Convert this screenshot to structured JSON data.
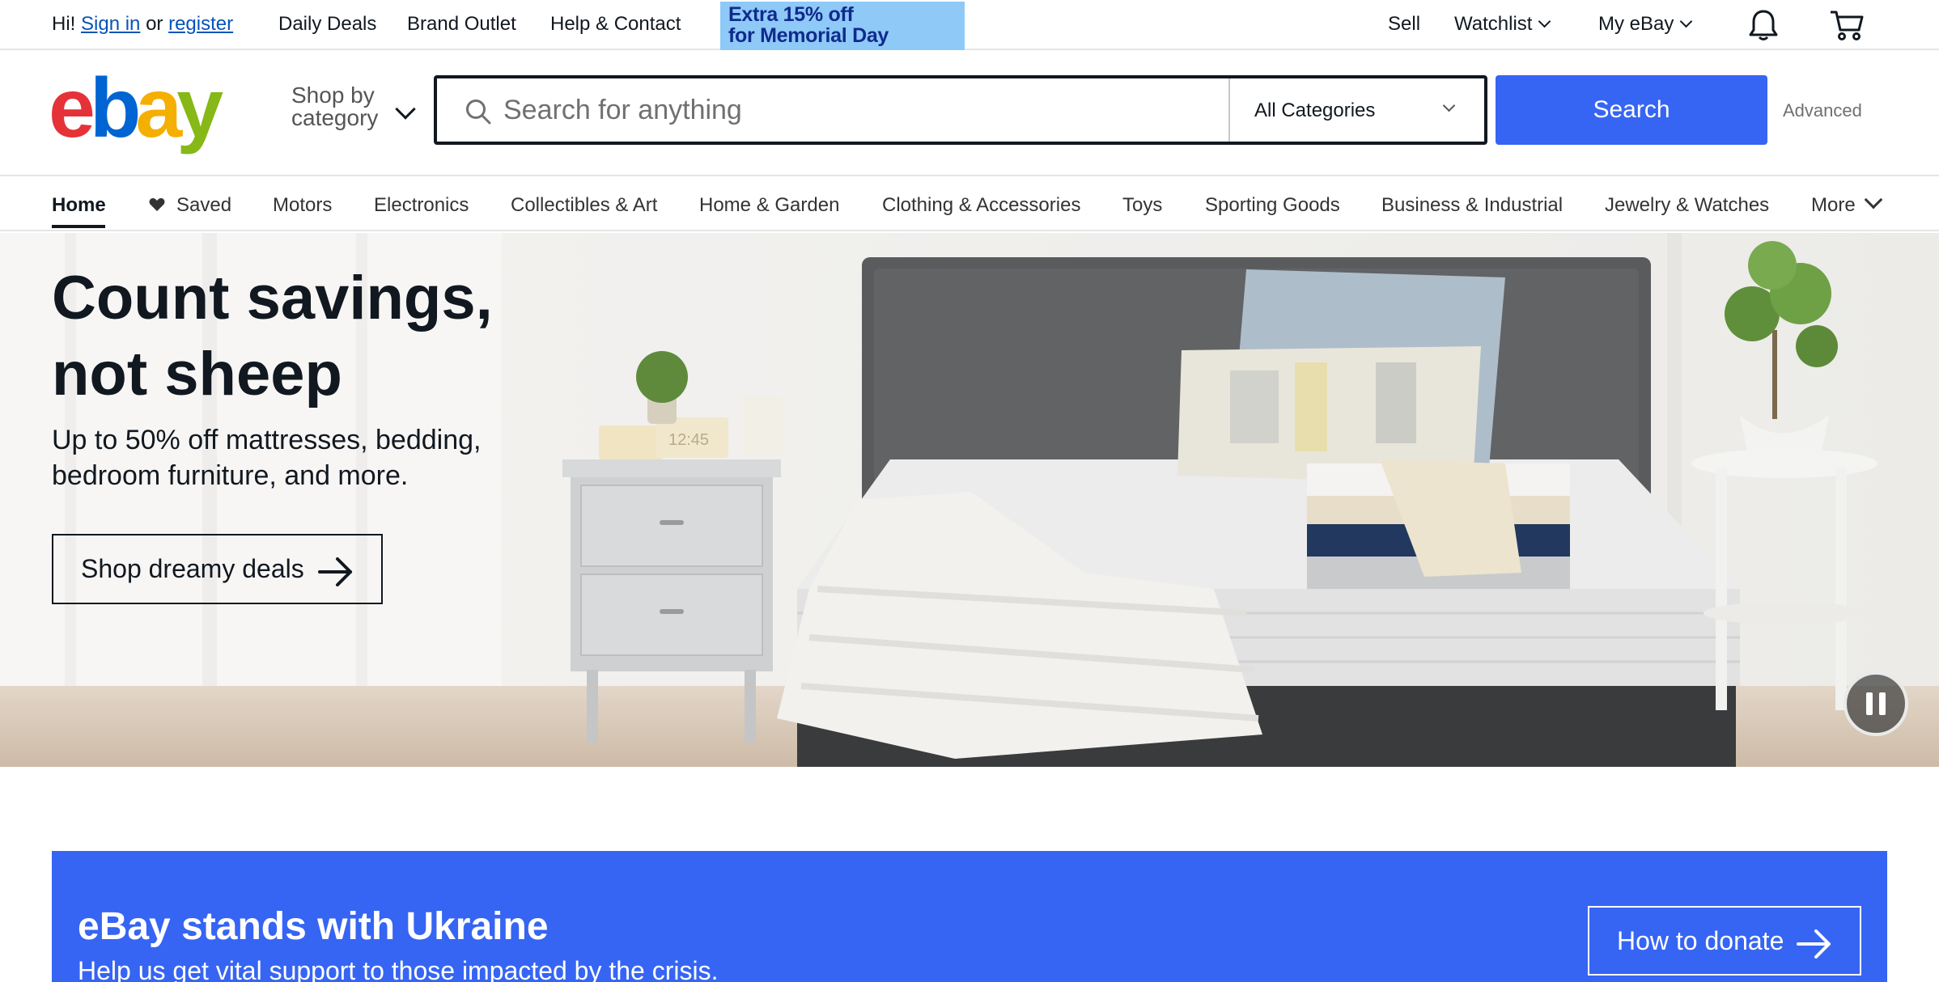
{
  "topbar": {
    "greeting_prefix": "Hi!",
    "sign_in": "Sign in",
    "or": "or",
    "register": "register",
    "links": [
      "Daily Deals",
      "Brand Outlet",
      "Help & Contact"
    ],
    "promo_line1": "Extra 15% off",
    "promo_line2": "for Memorial Day",
    "sell": "Sell",
    "watchlist": "Watchlist",
    "my_ebay": "My eBay"
  },
  "header": {
    "logo": [
      "e",
      "b",
      "a",
      "y"
    ],
    "shop_by_line1": "Shop by",
    "shop_by_line2": "category",
    "search_placeholder": "Search for anything",
    "category_select": "All Categories",
    "search_button": "Search",
    "advanced": "Advanced"
  },
  "nav": {
    "items": [
      "Home",
      "Saved",
      "Motors",
      "Electronics",
      "Collectibles & Art",
      "Home & Garden",
      "Clothing & Accessories",
      "Toys",
      "Sporting Goods",
      "Business & Industrial",
      "Jewelry & Watches",
      "More"
    ]
  },
  "hero": {
    "title_line1": "Count savings,",
    "title_line2": "not sheep",
    "subtitle": "Up to 50% off mattresses, bedding, bedroom furniture, and more.",
    "cta": "Shop dreamy deals",
    "clock_text": "12:45"
  },
  "ukraine": {
    "title": "eBay stands with Ukraine",
    "subtitle": "Help us get vital support to those impacted by the crisis.",
    "button": "How to donate"
  },
  "colors": {
    "brand_blue": "#3665f3",
    "promo_bg": "#8ec9f8",
    "logo_red": "#e53238",
    "logo_blue": "#0064d2",
    "logo_yellow": "#f5af02",
    "logo_green": "#86b817"
  }
}
